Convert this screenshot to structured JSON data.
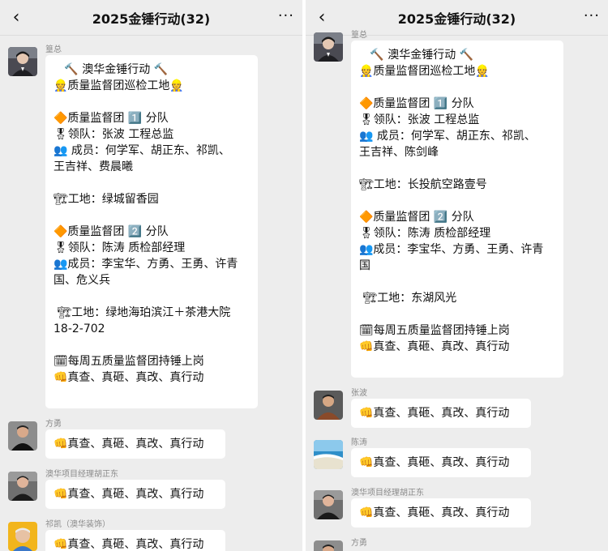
{
  "left": {
    "title": "2025金锤行动(32)",
    "back_icon": "‹",
    "more_icon": "···",
    "messages": [
      {
        "sender": "篁总",
        "lines": [
          "   🔨 澳华金锤行动 🔨",
          "👷质量监督团巡检工地👷",
          "",
          "🔶质量监督团 1️⃣ 分队",
          "🎖领队：张波 工程总监",
          "👥 成员：何学军、胡正东、祁凯、",
          "王吉祥、费晨曦",
          "",
          "🏗工地：绿城留香园",
          "",
          "🔶质量监督团 2️⃣ 分队",
          "🎖领队：陈涛 质检部经理",
          "👥成员：李宝华、方勇、王勇、许青",
          "国、危义兵",
          "",
          " 🏗工地：绿地海珀滨江＋茶港大院",
          "18-2-702",
          "",
          "🗓每周五质量监督团持锤上岗",
          "👊真查、真砸、真改、真行动"
        ]
      },
      {
        "sender": "方勇",
        "text": "👊真查、真砸、真改、真行动"
      },
      {
        "sender": "澳华项目经理胡正东",
        "text": "👊真查、真砸、真改、真行动"
      },
      {
        "sender": "祁凯（澳华装饰）",
        "text": "👊真查、真砸、真改、真行动"
      }
    ]
  },
  "right": {
    "title": "2025金锤行动(32)",
    "back_icon": "‹",
    "more_icon": "···",
    "messages": [
      {
        "sender": "篁总",
        "lines": [
          "   🔨 澳华金锤行动 🔨",
          "👷质量监督团巡检工地👷",
          "",
          "🔶质量监督团 1️⃣ 分队",
          "🎖领队：张波 工程总监",
          "👥 成员：何学军、胡正东、祁凯、",
          "王吉祥、陈剑峰",
          "",
          "🏗工地：长投航空路壹号",
          "",
          "🔶质量监督团 2️⃣ 分队",
          "🎖领队：陈涛 质检部经理",
          "👥成员：李宝华、方勇、王勇、许青",
          "国",
          "",
          " 🏗工地：东湖风光",
          "",
          "🗓每周五质量监督团持锤上岗",
          "👊真查、真砸、真改、真行动"
        ]
      },
      {
        "sender": "张波",
        "text": "👊真查、真砸、真改、真行动"
      },
      {
        "sender": "陈涛",
        "text": "👊真查、真砸、真改、真行动"
      },
      {
        "sender": "澳华项目经理胡正东",
        "text": "👊真查、真砸、真改、真行动"
      },
      {
        "sender": "方勇",
        "text": ""
      }
    ]
  },
  "colors": {
    "chat_background": "#ededed",
    "bubble_background": "#ffffff",
    "sender_name": "#8a8a8a"
  }
}
